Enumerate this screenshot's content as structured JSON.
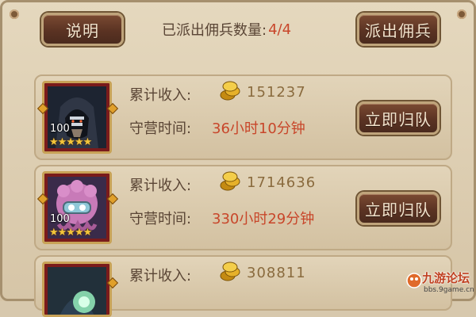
{
  "header": {
    "help_label": "说明",
    "count_label": "已派出佣兵数量:",
    "count_value": "4/4",
    "dispatch_label": "派出佣兵"
  },
  "labels": {
    "income": "累计收入:",
    "guard_time": "守营时间:"
  },
  "mercenaries": [
    {
      "level": "100",
      "stars": 5,
      "stars_text": "★★★★★",
      "income": "151237",
      "guard_time": "36小时10分钟",
      "recall_label": "立即归队",
      "portrait_icon": "hooded-mercenary-icon"
    },
    {
      "level": "100",
      "stars": 5,
      "stars_text": "★★★★★",
      "income": "1714636",
      "guard_time": "330小时29分钟",
      "recall_label": "立即归队",
      "portrait_icon": "pink-octopus-mercenary-icon"
    },
    {
      "income": "308811",
      "portrait_icon": "green-orb-mercenary-icon"
    }
  ],
  "watermark": {
    "title": "九游论坛",
    "url": "bbs.9game.cn"
  },
  "colors": {
    "accent_red": "#c8462a",
    "button_brown": "#5b3323",
    "panel_tan": "#e2d4b9"
  }
}
